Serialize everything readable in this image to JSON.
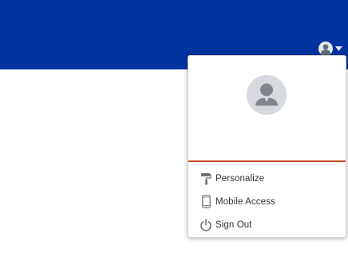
{
  "colors": {
    "header_bg": "#0033a0",
    "divider": "#c8501e",
    "icon_gray": "#6b7378",
    "text": "#333333"
  },
  "user_menu": {
    "toggle_icon": "user-avatar-icon",
    "caret_icon": "caret-down-icon",
    "avatar_icon": "user-avatar-icon",
    "items": [
      {
        "label": "Personalize",
        "icon": "paint-roller-icon"
      },
      {
        "label": "Mobile Access",
        "icon": "mobile-phone-icon"
      },
      {
        "label": "Sign Out",
        "icon": "power-icon"
      }
    ]
  }
}
